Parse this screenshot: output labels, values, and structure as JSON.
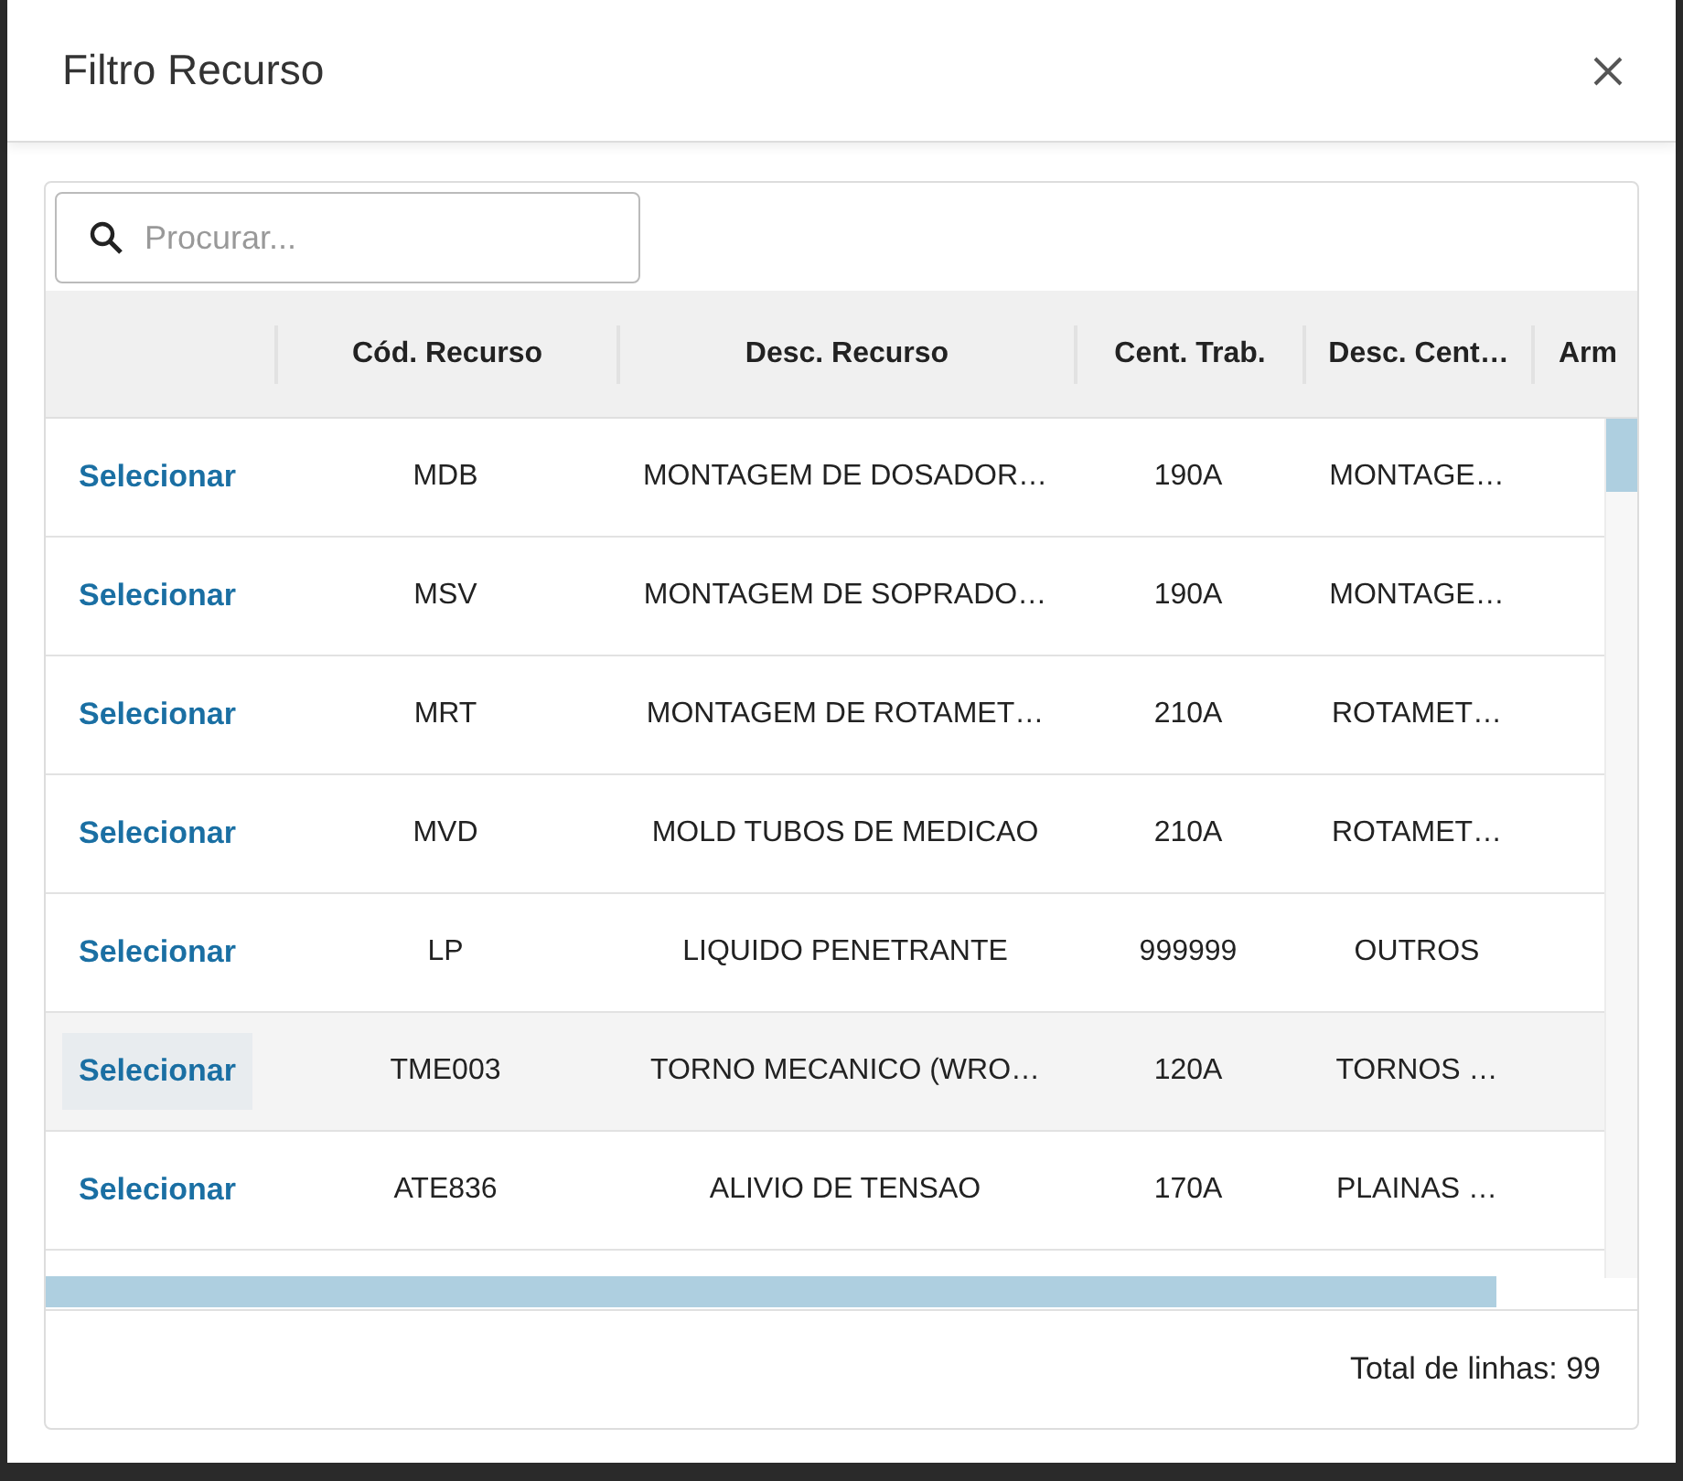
{
  "dialog": {
    "title": "Filtro Recurso"
  },
  "search": {
    "placeholder": "Procurar..."
  },
  "table": {
    "columns": [
      "",
      "Cód. Recurso",
      "Desc. Recurso",
      "Cent. Trab.",
      "Desc. Cent…",
      "Arm"
    ],
    "rows": [
      {
        "action": "Selecionar",
        "code": "MDB",
        "description": "MONTAGEM DE DOSADOR…",
        "work_center": "190A",
        "work_center_desc": "MONTAGE…",
        "hovered": false
      },
      {
        "action": "Selecionar",
        "code": "MSV",
        "description": "MONTAGEM DE SOPRADO…",
        "work_center": "190A",
        "work_center_desc": "MONTAGE…",
        "hovered": false
      },
      {
        "action": "Selecionar",
        "code": "MRT",
        "description": "MONTAGEM DE ROTAMET…",
        "work_center": "210A",
        "work_center_desc": "ROTAMET…",
        "hovered": false
      },
      {
        "action": "Selecionar",
        "code": "MVD",
        "description": "MOLD TUBOS DE MEDICAO",
        "work_center": "210A",
        "work_center_desc": "ROTAMET…",
        "hovered": false
      },
      {
        "action": "Selecionar",
        "code": "LP",
        "description": "LIQUIDO PENETRANTE",
        "work_center": "999999",
        "work_center_desc": "OUTROS",
        "hovered": false
      },
      {
        "action": "Selecionar",
        "code": "TME003",
        "description": "TORNO MECANICO (WRO…",
        "work_center": "120A",
        "work_center_desc": "TORNOS …",
        "hovered": true
      },
      {
        "action": "Selecionar",
        "code": "ATE836",
        "description": "ALIVIO DE TENSAO",
        "work_center": "170A",
        "work_center_desc": "PLAINAS …",
        "hovered": false
      }
    ]
  },
  "footer": {
    "total": "Total de linhas: 99"
  }
}
